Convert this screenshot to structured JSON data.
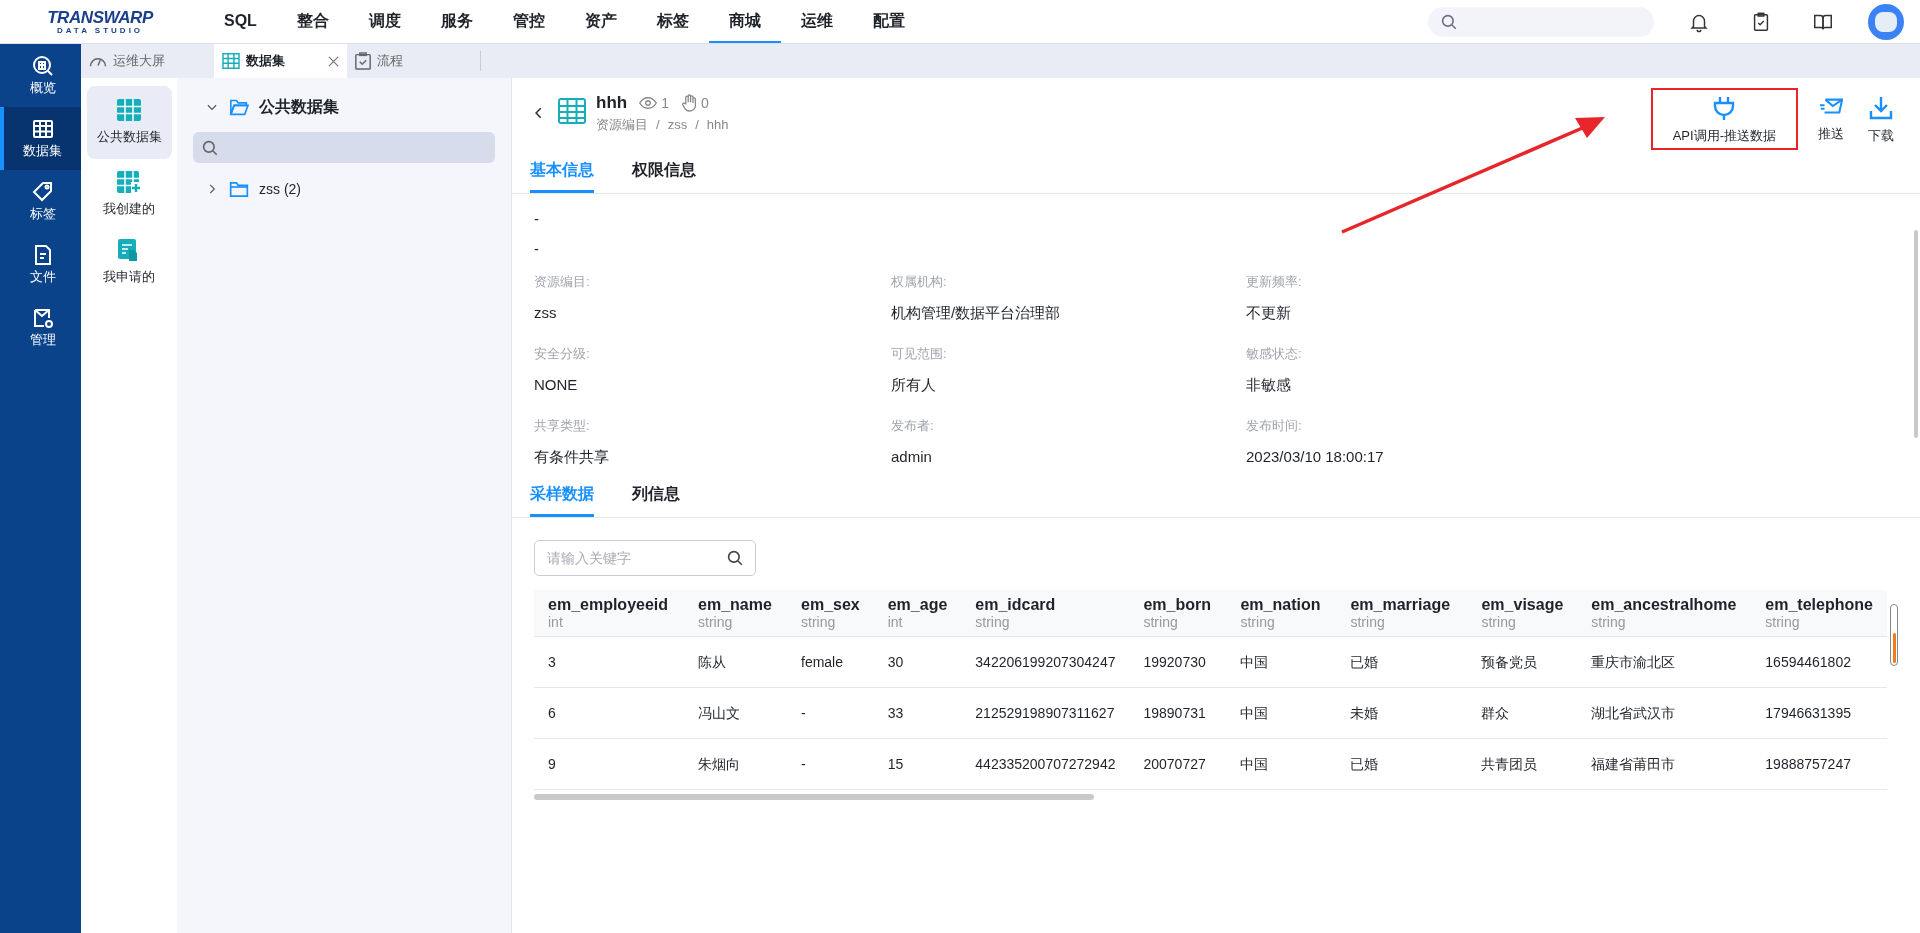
{
  "top_nav": {
    "logo_line1": "TRANSWARP",
    "logo_line2": "DATA STUDIO",
    "items": [
      {
        "label": "SQL",
        "selected": false
      },
      {
        "label": "整合",
        "selected": false
      },
      {
        "label": "调度",
        "selected": false
      },
      {
        "label": "服务",
        "selected": false
      },
      {
        "label": "管控",
        "selected": false
      },
      {
        "label": "资产",
        "selected": false
      },
      {
        "label": "标签",
        "selected": false
      },
      {
        "label": "商城",
        "selected": true
      },
      {
        "label": "运维",
        "selected": false
      },
      {
        "label": "配置",
        "selected": false
      }
    ]
  },
  "side_nav": [
    {
      "label": "概览",
      "kind": "overview",
      "selected": false
    },
    {
      "label": "数据集",
      "kind": "grid",
      "selected": true
    },
    {
      "label": "标签",
      "kind": "tag",
      "selected": false
    },
    {
      "label": "文件",
      "kind": "file",
      "selected": false
    },
    {
      "label": "管理",
      "kind": "manage",
      "selected": false
    }
  ],
  "tabs": [
    {
      "label": "运维大屏",
      "kind": "gauge",
      "selected": false,
      "closable": false
    },
    {
      "label": "数据集",
      "kind": "grid",
      "selected": true,
      "closable": true
    },
    {
      "label": "流程",
      "kind": "clipboard",
      "selected": false,
      "closable": false
    }
  ],
  "sub_nav": [
    {
      "label": "公共数据集",
      "kind": "grid",
      "selected": true
    },
    {
      "label": "我创建的",
      "kind": "grid-plus",
      "selected": false
    },
    {
      "label": "我申请的",
      "kind": "apply",
      "selected": false
    }
  ],
  "tree": {
    "root": "公共数据集",
    "expanded": true,
    "children": [
      {
        "label": "zss (2)",
        "expanded": false
      }
    ]
  },
  "detail": {
    "title": "hhh",
    "views": "1",
    "likes": "0",
    "breadcrumb": [
      {
        "label": "资源编目"
      },
      {
        "label": "zss",
        "separator": "/"
      },
      {
        "label": "hhh",
        "separator": "/"
      }
    ],
    "actions": [
      {
        "label": "API调用-推送数据",
        "kind": "plug",
        "highlighted": true
      },
      {
        "label": "推送",
        "kind": "mail",
        "highlighted": false
      },
      {
        "label": "下载",
        "kind": "download",
        "highlighted": false
      }
    ],
    "tabs": [
      {
        "label": "基本信息",
        "selected": true
      },
      {
        "label": "权限信息",
        "selected": false
      }
    ],
    "descriptions": [
      "-",
      "-"
    ],
    "fields": [
      {
        "label": "资源编目:",
        "value": "zss"
      },
      {
        "label": "权属机构:",
        "value": "机构管理/数据平台治理部"
      },
      {
        "label": "更新频率:",
        "value": "不更新"
      },
      {
        "label": "安全分级:",
        "value": "NONE"
      },
      {
        "label": "可见范围:",
        "value": "所有人"
      },
      {
        "label": "敏感状态:",
        "value": "非敏感"
      },
      {
        "label": "共享类型:",
        "value": "有条件共享"
      },
      {
        "label": "发布者:",
        "value": "admin"
      },
      {
        "label": "发布时间:",
        "value": "2023/03/10 18:00:17"
      }
    ],
    "sample_tabs": [
      {
        "label": "采样数据",
        "selected": true
      },
      {
        "label": "列信息",
        "selected": false
      }
    ],
    "search": {
      "placeholder": "请输入关键字"
    },
    "table": {
      "columns": [
        {
          "name": "em_employeeid",
          "type": "int"
        },
        {
          "name": "em_name",
          "type": "string"
        },
        {
          "name": "em_sex",
          "type": "string"
        },
        {
          "name": "em_age",
          "type": "int"
        },
        {
          "name": "em_idcard",
          "type": "string"
        },
        {
          "name": "em_born",
          "type": "string"
        },
        {
          "name": "em_nation",
          "type": "string"
        },
        {
          "name": "em_marriage",
          "type": "string"
        },
        {
          "name": "em_visage",
          "type": "string"
        },
        {
          "name": "em_ancestralhome",
          "type": "string"
        },
        {
          "name": "em_telephone",
          "type": "string"
        }
      ],
      "rows": [
        [
          "3",
          "陈从",
          "female",
          "30",
          "342206199207304247",
          "19920730",
          "中国",
          "已婚",
          "预备党员",
          "重庆市渝北区",
          "16594461802"
        ],
        [
          "6",
          "冯山文",
          "-",
          "33",
          "212529198907311627",
          "19890731",
          "中国",
          "未婚",
          "群众",
          "湖北省武汉市",
          "17946631395"
        ],
        [
          "9",
          "朱烟向",
          "-",
          "15",
          "442335200707272942",
          "20070727",
          "中国",
          "已婚",
          "共青团员",
          "福建省莆田市",
          "19888757247"
        ]
      ]
    }
  }
}
